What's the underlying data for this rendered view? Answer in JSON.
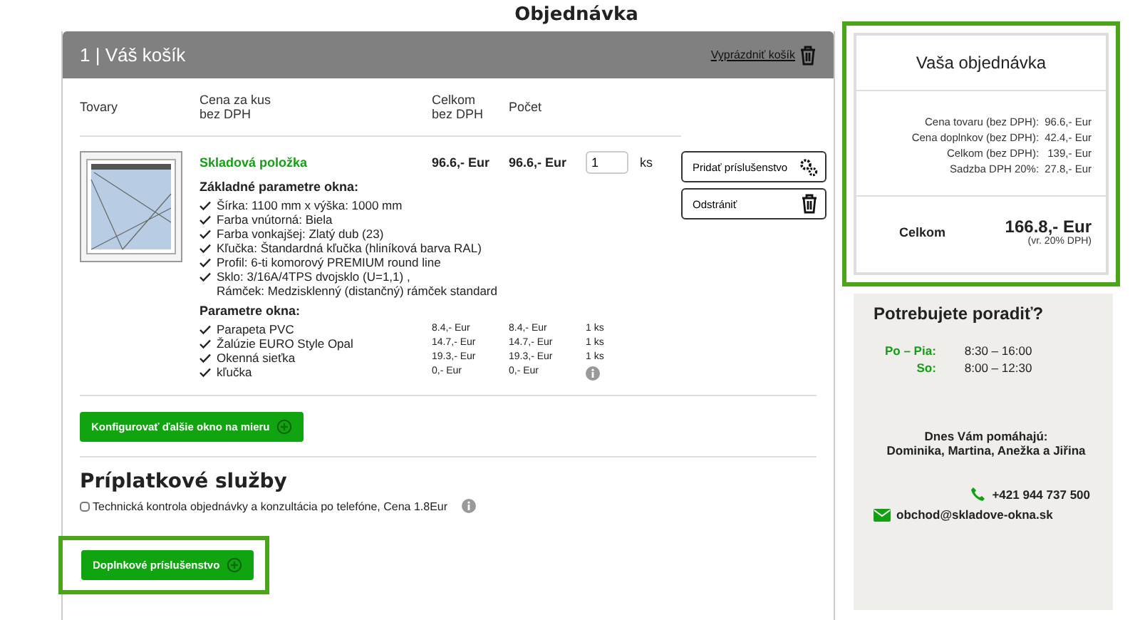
{
  "page_title": "Objednávka",
  "cart": {
    "title": "1 | Váš košík",
    "empty_link": "Vyprázdniť košík",
    "columns": [
      {
        "lines": [
          "Tovary"
        ]
      },
      {
        "lines": [
          "Cena za kus",
          "bez DPH"
        ]
      },
      {
        "lines": [
          "Celkom",
          "bez DPH"
        ]
      },
      {
        "lines": [
          "Počet"
        ]
      }
    ],
    "item": {
      "status": "Skladová položka",
      "unit_price": "96.6,- Eur",
      "total": "96.6,- Eur",
      "quantity": "1",
      "unit": "ks",
      "base_heading": "Základné parametre okna:",
      "base_params": [
        [
          "Šírka: 1100 mm x výška: 1000 mm"
        ],
        [
          "Farba vnútorná: Biela"
        ],
        [
          "Farba vonkajšej: Zlatý dub (23)"
        ],
        [
          "Kľučka: Štandardná kľučka (hliníková barva RAL)"
        ],
        [
          "Profil: 6-ti komorový PREMIUM round line"
        ],
        [
          "Sklo: 3/16A/4TPS dvojsklo (U=1,1) ,",
          "Rámček: Medzisklenný (distančný) rámček standard"
        ]
      ],
      "params_heading": "Parametre okna:",
      "accessories": [
        {
          "kind": "count",
          "name": "Parapeta PVC",
          "unit_price": "8.4,- Eur",
          "total": "8.4,- Eur",
          "quantity": "1 ks"
        },
        {
          "kind": "count",
          "name": "Žalúzie EURO Style Opal",
          "unit_price": "14.7,- Eur",
          "total": "14.7,- Eur",
          "quantity": "1 ks"
        },
        {
          "kind": "count",
          "name": "Okenná sieťka",
          "unit_price": "19.3,- Eur",
          "total": "19.3,- Eur",
          "quantity": "1 ks"
        },
        {
          "kind": "info",
          "name": "kľučka",
          "unit_price": "0,- Eur",
          "total": "0,- Eur"
        }
      ],
      "buttons": [
        {
          "kind": "accessories",
          "label": "Pridať príslušenstvo"
        },
        {
          "kind": "remove",
          "label": "Odstrániť"
        }
      ]
    },
    "configure_button": "Konfigurovať ďalšie okno na mieru"
  },
  "extras": {
    "heading": "Príplatkové služby",
    "options": [
      {
        "label": "Technická kontrola objednávky a konzultácia po telefóne, Cena 1.8Eur",
        "checked": false
      }
    ]
  },
  "accessories_button": {
    "label": "Doplnkové príslušenstvo",
    "highlighted": true
  },
  "summary": {
    "highlighted": true,
    "title": "Vaša objednávka",
    "rows": [
      {
        "label": "Cena tovaru (bez DPH):",
        "value": "96.6,- Eur"
      },
      {
        "label": "Cena doplnkov (bez DPH):",
        "value": "42.4,- Eur"
      },
      {
        "label": "Celkom (bez DPH):",
        "value": "139,- Eur"
      },
      {
        "label": "Sadzba DPH 20%:",
        "value": "27.8,- Eur"
      }
    ],
    "total_label": "Celkom",
    "total": "166.8,- Eur",
    "total_note": "(vr. 20% DPH)"
  },
  "help": {
    "title": "Potrebujete poradiť?",
    "hours": [
      {
        "days": "Po – Pia:",
        "time": "8:30 – 16:00"
      },
      {
        "days": "So:",
        "time": "8:00 – 12:30"
      }
    ],
    "staff_heading": "Dnes Vám pomáhajú:",
    "staff_names": "Dominika, Martina, Anežka a Jiřina",
    "phone": "+421 944 737 500",
    "email": "obchod@skladove-okna.sk"
  }
}
